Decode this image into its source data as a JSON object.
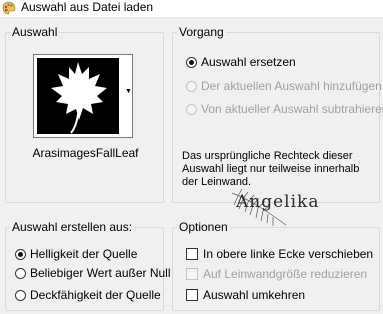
{
  "window": {
    "title": "Auswahl aus Datei laden"
  },
  "auswahl": {
    "legend": "Auswahl",
    "thumbnail_caption": "ArasimagesFallLeaf",
    "dropdown_glyph": "▼"
  },
  "vorgang": {
    "legend": "Vorgang",
    "options": [
      {
        "label": "Auswahl ersetzen",
        "checked": true,
        "enabled": true
      },
      {
        "label": "Der aktuellen Auswahl hinzufügen",
        "checked": false,
        "enabled": false
      },
      {
        "label": "Von aktueller Auswahl subtrahieren",
        "checked": false,
        "enabled": false
      }
    ],
    "note": "Das ursprüngliche Rechteck dieser Auswahl liegt nur teilweise innerhalb der Leinwand."
  },
  "erstellen": {
    "legend": "Auswahl erstellen aus:",
    "options": [
      {
        "label": "Helligkeit der Quelle",
        "checked": true
      },
      {
        "label": "Beliebiger Wert außer Null",
        "checked": false
      },
      {
        "label": "Deckfähigkeit der Quelle",
        "checked": false
      }
    ]
  },
  "optionen": {
    "legend": "Optionen",
    "checkboxes": [
      {
        "label": "In obere linke Ecke verschieben",
        "checked": false,
        "enabled": true
      },
      {
        "label": "Auf Leinwandgröße reduzieren",
        "checked": false,
        "enabled": false
      },
      {
        "label": "Auswahl umkehren",
        "checked": false,
        "enabled": true
      }
    ]
  },
  "watermark": {
    "text": "Angelika"
  },
  "icons": {
    "app": "paint-palette-icon",
    "leaf": "maple-leaf-icon",
    "feather": "feather-icon"
  },
  "colors": {
    "border": "#d9d9d9",
    "disabled_text": "#a0a0a0",
    "background": "#f0f0f0"
  }
}
